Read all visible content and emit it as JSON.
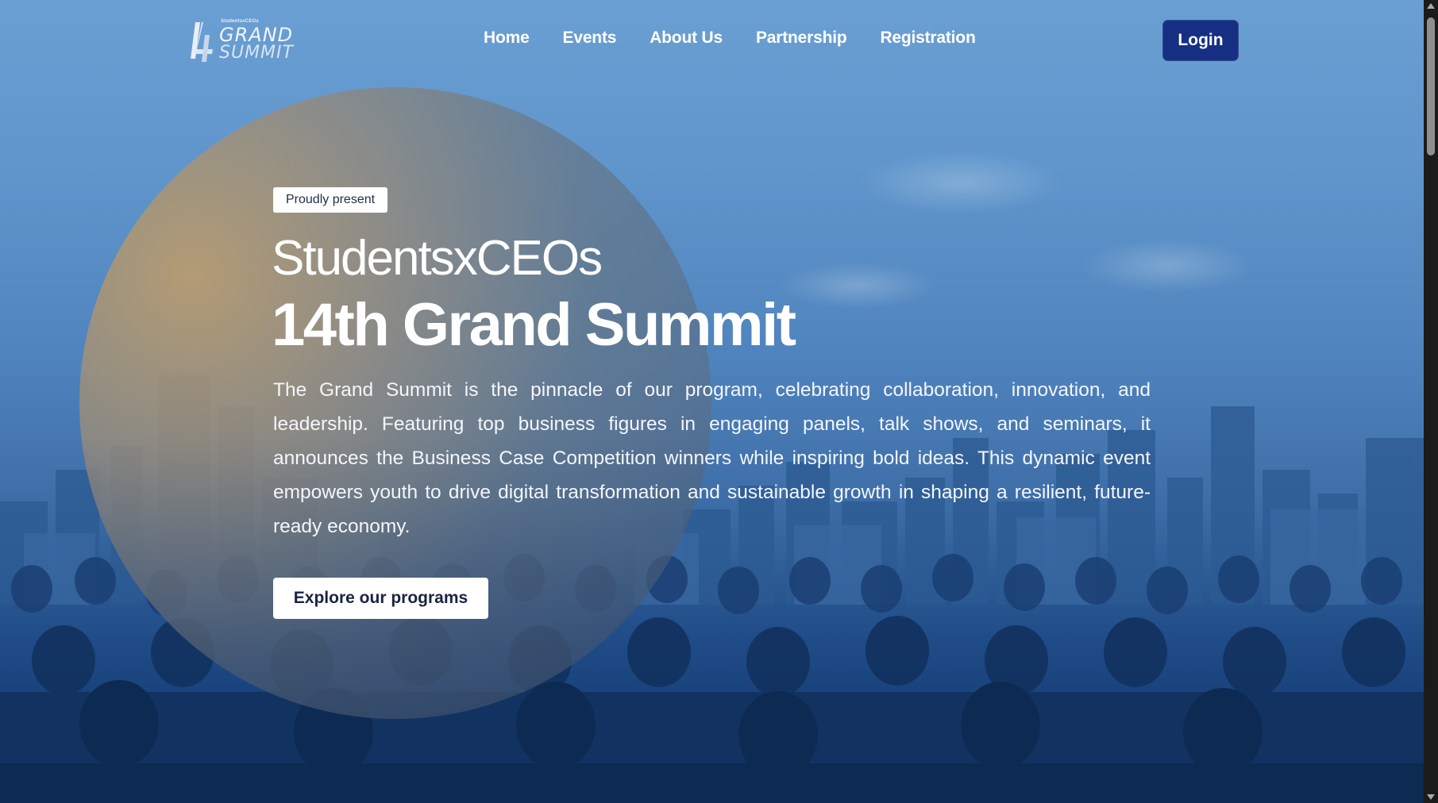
{
  "brand": {
    "logo_small_text": "StudentsxCEOs",
    "logo_line1": "GRAND",
    "logo_line2": "SUMMIT",
    "logo_icon": "14-monogram-icon"
  },
  "nav": {
    "items": [
      {
        "label": "Home"
      },
      {
        "label": "Events"
      },
      {
        "label": "About Us"
      },
      {
        "label": "Partnership"
      },
      {
        "label": "Registration"
      }
    ],
    "login_label": "Login"
  },
  "hero": {
    "badge": "Proudly present",
    "title_sub": "StudentsxCEOs",
    "title_main": "14th Grand Summit",
    "description": "The Grand Summit is the pinnacle of our program, celebrating collaboration, innovation, and leadership. Featuring top business figures in engaging panels, talk shows, and seminars, it announces the Business Case Competition winners while inspiring bold ideas. This dynamic event empowers youth to drive digital transformation and sustainable growth in shaping a resilient, future-ready economy.",
    "cta_label": "Explore our programs"
  },
  "colors": {
    "login_bg": "#162f82",
    "sky_top": "#6a9fd3",
    "sky_bottom": "#0f3268",
    "circle_accent": "#b89c70"
  }
}
